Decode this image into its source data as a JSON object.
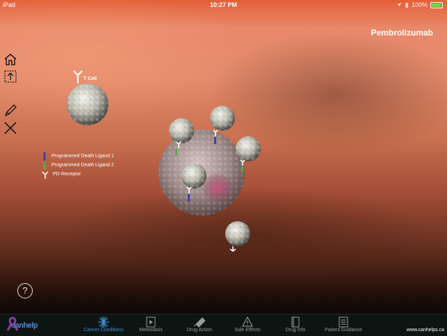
{
  "status_bar": {
    "device": "iPad",
    "time": "10:27 PM",
    "battery": "100%"
  },
  "drug_title": "Pembrolizumab",
  "cell_label": "T Cell",
  "legend": [
    {
      "label": "Programmed Death Ligand 1",
      "icon": "pd-l1-icon",
      "color": "#4a3aa8"
    },
    {
      "label": "Programmed Death Ligand 2",
      "icon": "pd-l2-icon",
      "color": "#5aa84a"
    },
    {
      "label": "PD-Receptor",
      "icon": "pd-receptor-icon",
      "color": "#ffffff"
    }
  ],
  "help_label": "?",
  "tabs": [
    {
      "label": "Cancer Conditions",
      "icon": "starburst-icon",
      "active": true
    },
    {
      "label": "Metastasis",
      "icon": "film-icon",
      "active": false
    },
    {
      "label": "Drug Action",
      "icon": "syringe-icon",
      "active": false
    },
    {
      "label": "Side Effects",
      "icon": "warning-icon",
      "active": false
    },
    {
      "label": "Drug Info",
      "icon": "book-icon",
      "active": false
    },
    {
      "label": "Patient Guidance",
      "icon": "document-icon",
      "active": false
    }
  ],
  "logo_text": "canhelp",
  "website": "www.canhelps.ca",
  "colors": {
    "accent": "#3d8ed8",
    "tab_bar_bg": "#0d1512",
    "status_bar_bg": "#e35f38"
  }
}
